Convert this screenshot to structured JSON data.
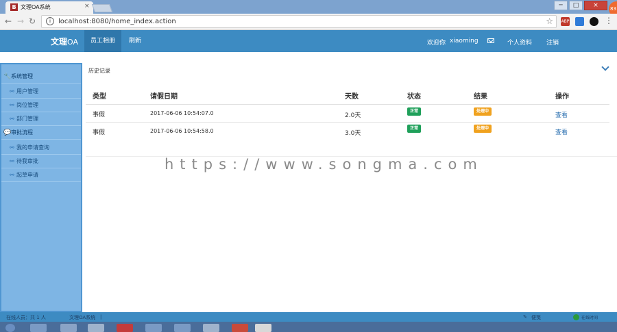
{
  "browser": {
    "tab_title": "文理OA系统",
    "tab_favicon": "B",
    "tab_close": "×",
    "url": "localhost:8080/home_index.action",
    "ext_badge": "83",
    "window_buttons": {
      "min": "─",
      "max": "□",
      "close": "×"
    },
    "extensions": [
      {
        "name": "adblock-icon",
        "label": "ABP",
        "color": "#c0392b"
      },
      {
        "name": "extension-blue-icon",
        "label": "",
        "color": "#2f7bd8"
      },
      {
        "name": "extension-dark-icon",
        "label": "",
        "color": "#111111"
      }
    ]
  },
  "app": {
    "brand_main": "文理",
    "brand_suffix": "OA",
    "menu": [
      {
        "label": "员工相册",
        "active": true
      },
      {
        "label": "刷新",
        "active": false
      }
    ],
    "welcome": "欢迎你",
    "username": "xiaoming",
    "profile_label": "个人资料",
    "logout_label": "注销"
  },
  "sidebar": {
    "groups": [
      {
        "label": "系统管理",
        "icon": "wrench-icon",
        "items": [
          "用户管理",
          "岗位管理",
          "部门管理"
        ]
      },
      {
        "label": "审批流程",
        "icon": "chat-icon",
        "items": [
          "我的申请查询",
          "待我审批",
          "起草申请"
        ]
      }
    ]
  },
  "main": {
    "section_title": "历史记录",
    "headers": [
      "类型",
      "请假日期",
      "天数",
      "状态",
      "结果",
      "操作"
    ],
    "rows": [
      {
        "type": "事假",
        "date": "2017-06-06 10:54:07.0",
        "days": "2.0天",
        "status": "正常",
        "result": "处理中",
        "action": "查看"
      },
      {
        "type": "事假",
        "date": "2017-06-06 10:54:58.0",
        "days": "3.0天",
        "status": "正常",
        "result": "处理中",
        "action": "查看"
      }
    ]
  },
  "watermark": "https://www.songma.com",
  "statusbar": {
    "online": "在线人员：共 1 人",
    "system": "文理OA系统",
    "separator": "|",
    "notes": "便笺",
    "timer": "在线时间"
  },
  "colors": {
    "appbar": "#3d8bc2",
    "sidebar": "#7eb5e4",
    "status_ok": "#1fa05a",
    "status_processing": "#f0a21f",
    "link": "#2a6fb0"
  }
}
